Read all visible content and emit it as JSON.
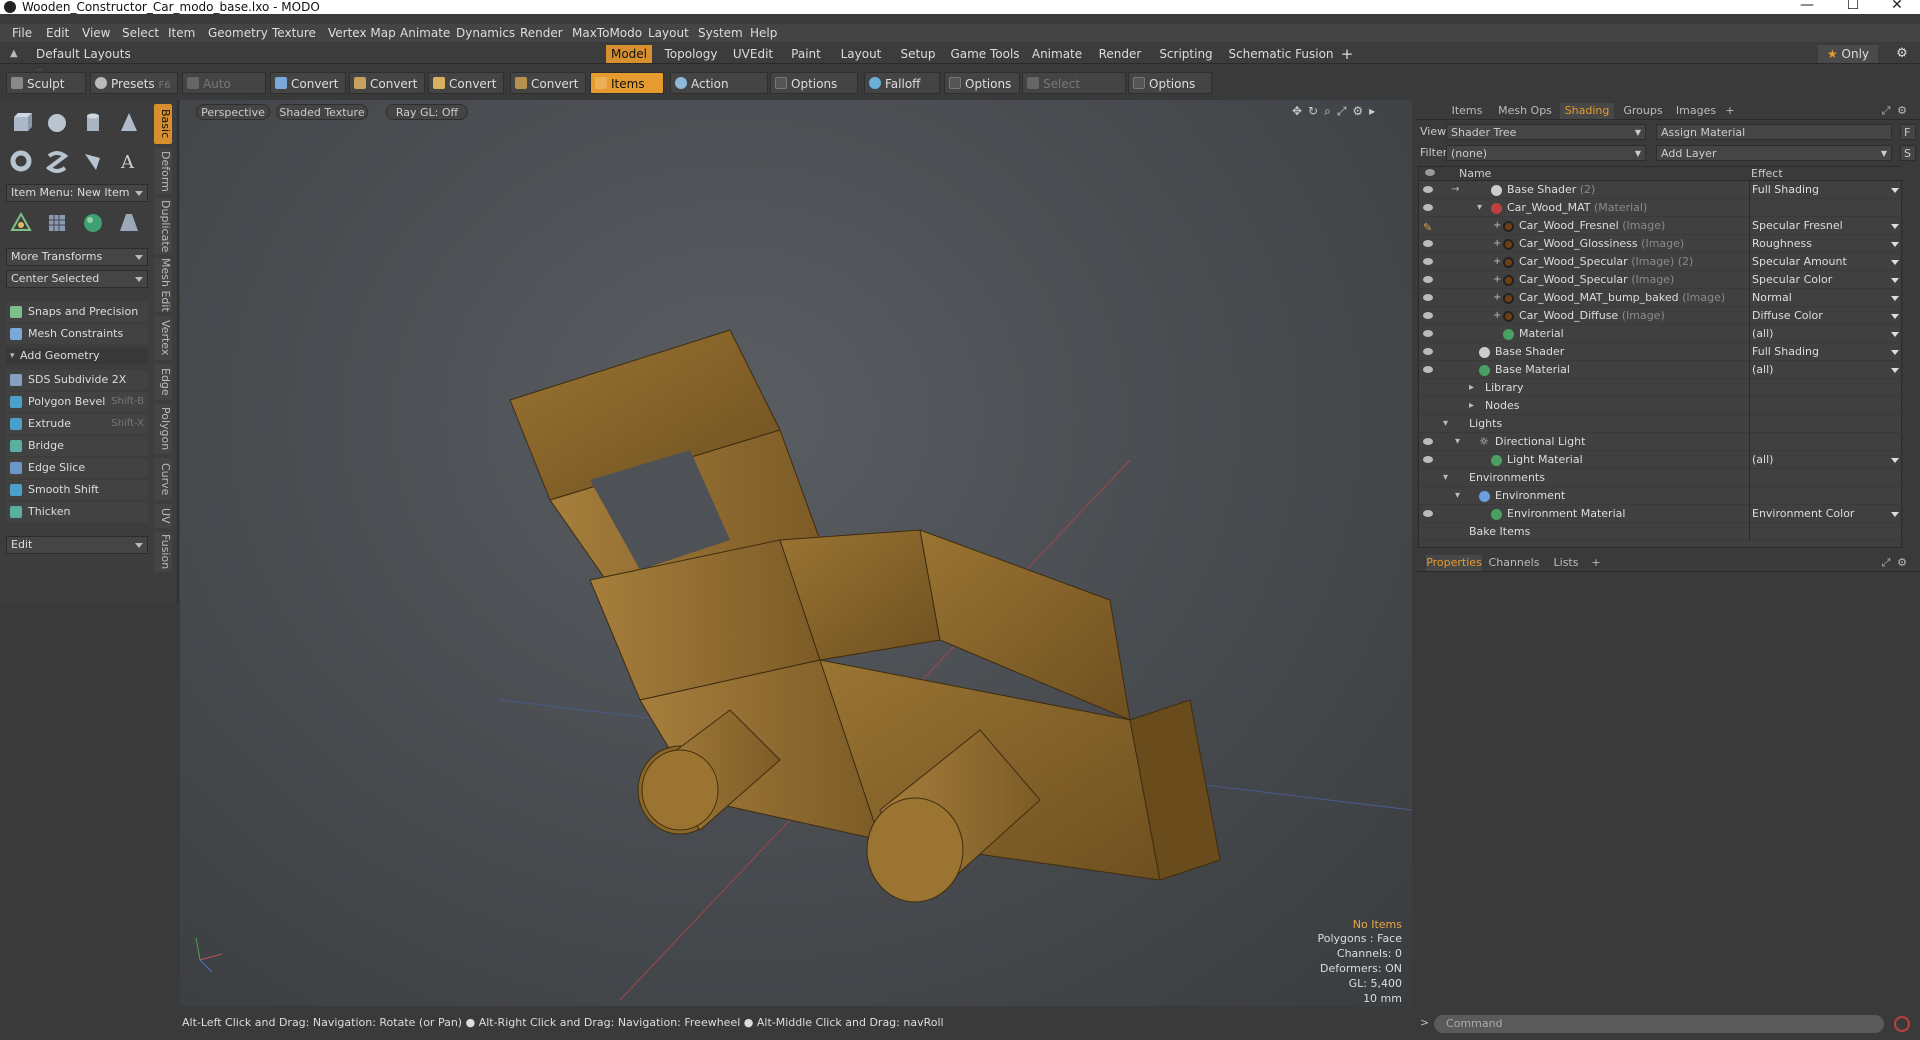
{
  "window": {
    "title": "Wooden_Constructor_Car_modo_base.lxo - MODO",
    "minimize": "—",
    "maximize": "☐",
    "close": "✕"
  },
  "menu": [
    "File",
    "Edit",
    "View",
    "Select",
    "Item",
    "Geometry",
    "Texture",
    "Vertex Map",
    "Animate",
    "Dynamics",
    "Render",
    "MaxToModo",
    "Layout",
    "System",
    "Help"
  ],
  "layoutbar": {
    "layouts_label": "Default Layouts",
    "tabs": [
      "Model",
      "Topology",
      "UVEdit",
      "Paint",
      "Layout",
      "Setup",
      "Game Tools",
      "Animate",
      "Render",
      "Scripting",
      "Schematic Fusion"
    ],
    "active_tab": "Model",
    "plus": "+",
    "only_label": "Only"
  },
  "toolbar": {
    "sculpt": "Sculpt",
    "presets": "Presets",
    "presets_key": "F6",
    "auto_select": "Auto Select",
    "convert1": "Convert",
    "convert2": "Convert",
    "convert3": "Convert",
    "convert4": "Convert",
    "items": "Items",
    "action_center": "Action Center",
    "options1": "Options",
    "falloff": "Falloff",
    "options2": "Options",
    "select_through": "Select Through",
    "options3": "Options"
  },
  "left": {
    "vtabs": [
      "Basic",
      "Deform",
      "Duplicate",
      "Mesh Edit",
      "Vertex",
      "Edge",
      "Polygon",
      "Curve",
      "UV",
      "Fusion"
    ],
    "item_menu": "Item Menu: New Item",
    "more_transforms": "More Transforms",
    "center_selected": "Center Selected",
    "snaps": "Snaps and Precision",
    "mesh_constraints": "Mesh Constraints",
    "add_geometry": "Add Geometry",
    "tools": [
      {
        "label": "SDS Subdivide 2X",
        "shortcut": ""
      },
      {
        "label": "Polygon Bevel",
        "shortcut": "Shift-B"
      },
      {
        "label": "Extrude",
        "shortcut": "Shift-X"
      },
      {
        "label": "Bridge",
        "shortcut": ""
      },
      {
        "label": "Edge Slice",
        "shortcut": ""
      },
      {
        "label": "Smooth Shift",
        "shortcut": ""
      },
      {
        "label": "Thicken",
        "shortcut": ""
      }
    ],
    "edit": "Edit"
  },
  "viewport": {
    "perspective": "Perspective",
    "shaded": "Shaded Texture",
    "raygl": "Ray GL: Off",
    "info": {
      "no_items": "No Items",
      "polygons": "Polygons : Face",
      "channels": "Channels: 0",
      "deformers": "Deformers: ON",
      "gl": "GL: 5,400",
      "scale": "10 mm"
    }
  },
  "statusbar": "Alt-Left Click and Drag: Navigation: Rotate (or Pan) ● Alt-Right Click and Drag: Navigation: Freewheel ● Alt-Middle Click and Drag: navRoll",
  "right": {
    "tabs": [
      "Items",
      "Mesh Ops",
      "Shading",
      "Groups",
      "Images",
      "+"
    ],
    "active_tab": "Shading",
    "view_label": "View",
    "view_value": "Shader Tree",
    "assign_material": "Assign Material",
    "f_btn": "F",
    "filter_label": "Filter",
    "filter_value": "(none)",
    "add_layer": "Add Layer",
    "s_btn": "S",
    "col_name": "Name",
    "col_effect": "Effect",
    "rows": [
      {
        "name": "Base Shader",
        "sub": "(2)",
        "effect": "Full Shading"
      },
      {
        "name": "Car_Wood_MAT",
        "sub": "(Material)",
        "effect": ""
      },
      {
        "name": "Car_Wood_Fresnel",
        "sub": "(Image)",
        "effect": "Specular Fresnel"
      },
      {
        "name": "Car_Wood_Glossiness",
        "sub": "(Image)",
        "effect": "Roughness"
      },
      {
        "name": "Car_Wood_Specular",
        "sub": "(Image) (2)",
        "effect": "Specular Amount"
      },
      {
        "name": "Car_Wood_Specular",
        "sub": "(Image)",
        "effect": "Specular Color"
      },
      {
        "name": "Car_Wood_MAT_bump_baked",
        "sub": "(Image)",
        "effect": "Normal"
      },
      {
        "name": "Car_Wood_Diffuse",
        "sub": "(Image)",
        "effect": "Diffuse Color"
      },
      {
        "name": "Material",
        "sub": "",
        "effect": "(all)"
      },
      {
        "name": "Base Shader",
        "sub": "",
        "effect": "Full Shading"
      },
      {
        "name": "Base Material",
        "sub": "",
        "effect": "(all)"
      },
      {
        "name": "Library",
        "sub": "",
        "effect": ""
      },
      {
        "name": "Nodes",
        "sub": "",
        "effect": ""
      },
      {
        "name": "Lights",
        "sub": "",
        "effect": ""
      },
      {
        "name": "Directional Light",
        "sub": "",
        "effect": ""
      },
      {
        "name": "Light Material",
        "sub": "",
        "effect": "(all)"
      },
      {
        "name": "Environments",
        "sub": "",
        "effect": ""
      },
      {
        "name": "Environment",
        "sub": "",
        "effect": ""
      },
      {
        "name": "Environment Material",
        "sub": "",
        "effect": "Environment Color"
      },
      {
        "name": "Bake Items",
        "sub": "",
        "effect": ""
      }
    ],
    "prop_tabs": [
      "Properties",
      "Channels",
      "Lists",
      "+"
    ],
    "command_placeholder": "Command"
  }
}
